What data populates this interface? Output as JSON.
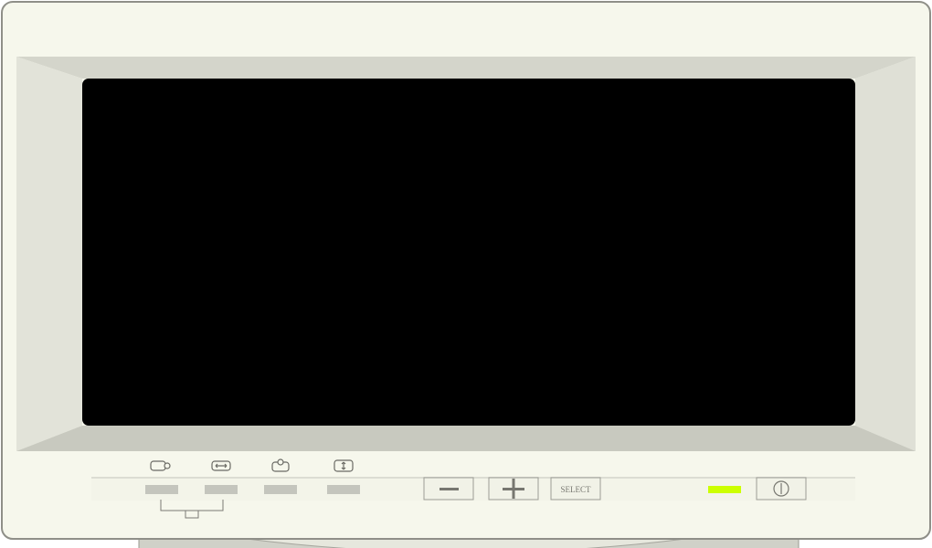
{
  "monitor": {
    "controls": {
      "minus_label": "−",
      "plus_label": "+",
      "select_label": "SELECT",
      "power_label": "⏻"
    },
    "adjust_icons": [
      "h-position-icon",
      "h-size-icon",
      "v-position-icon",
      "v-size-icon"
    ],
    "colors": {
      "bezel": "#f6f7ec",
      "frame": "#cfd0c6",
      "screen": "#000000",
      "power_led": "#ccff00"
    }
  }
}
